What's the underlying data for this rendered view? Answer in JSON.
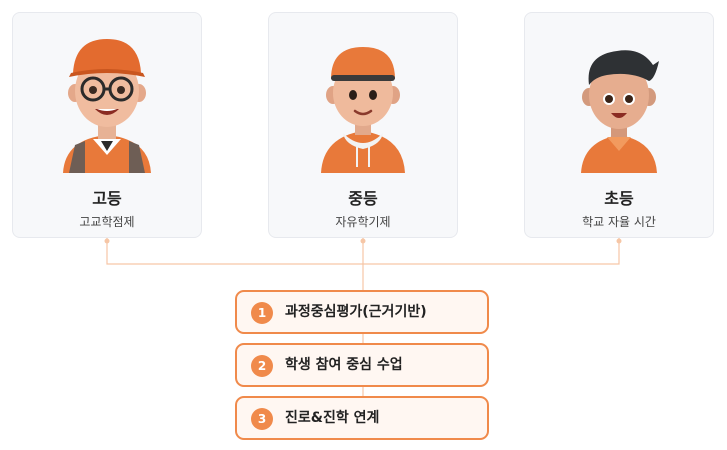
{
  "cards": [
    {
      "avatar": "high-school-student-avatar",
      "title": "고등",
      "subtitle": "고교학점제"
    },
    {
      "avatar": "middle-school-student-avatar",
      "title": "중등",
      "subtitle": "자유학기제"
    },
    {
      "avatar": "elementary-student-avatar",
      "title": "초등",
      "subtitle": "학교 자율 시간"
    }
  ],
  "steps": [
    {
      "number": "1",
      "label": "과정중심평가(근거기반)"
    },
    {
      "number": "2",
      "label": "학생 참여 중심 수업"
    },
    {
      "number": "3",
      "label": "진로&진학 연계"
    }
  ],
  "colors": {
    "accent": "#f08a4b",
    "connector": "#f6c6a6",
    "card_bg": "#f7f8fa"
  }
}
